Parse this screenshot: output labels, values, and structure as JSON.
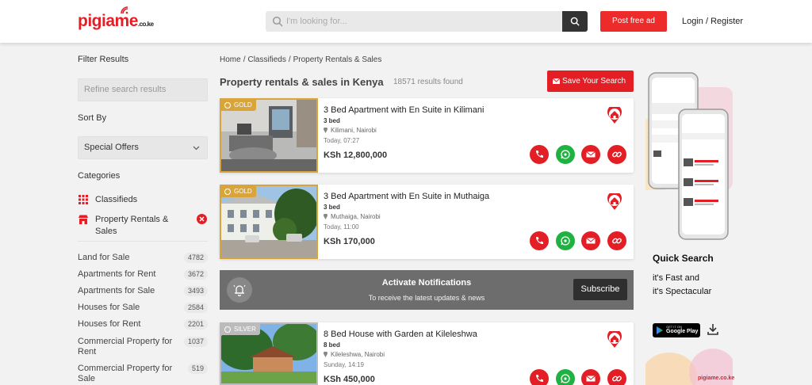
{
  "header": {
    "logo": {
      "part1": "pigia",
      "part2": "me",
      "tld": ".co.ke"
    },
    "search_placeholder": "I'm looking for...",
    "post_label": "Post free ad",
    "login_label": "Login / Register"
  },
  "sidebar": {
    "filter_title": "Filter Results",
    "refine_placeholder": "Refine search results",
    "sort_title": "Sort By",
    "sort_value": "Special Offers",
    "categories_title": "Categories",
    "categories": [
      {
        "label": "Classifieds",
        "icon": "grid-icon"
      },
      {
        "label": "Property Rentals & Sales",
        "icon": "store-icon"
      }
    ],
    "subcategories": [
      {
        "label": "Land for Sale",
        "count": "4782"
      },
      {
        "label": "Apartments for Rent",
        "count": "3672"
      },
      {
        "label": "Apartments for Sale",
        "count": "3493"
      },
      {
        "label": "Houses for Sale",
        "count": "2584"
      },
      {
        "label": "Houses for Rent",
        "count": "2201"
      },
      {
        "label": "Commercial Property for Rent",
        "count": "1037"
      },
      {
        "label": "Commercial Property for Sale",
        "count": "519"
      }
    ]
  },
  "main": {
    "breadcrumb": [
      "Home",
      "/",
      "Classifieds",
      "/",
      "Property Rentals & Sales"
    ],
    "title": "Property rentals & sales in Kenya",
    "results": "18571 results found",
    "save_search": "Save Your Search",
    "listings": [
      {
        "tier": "GOLD",
        "title": "3 Bed Apartment with En Suite in Kilimani",
        "beds": "3 bed",
        "location": "Kilimani, Nairobi",
        "time": "Today, 07:27",
        "price": "KSh 12,800,000"
      },
      {
        "tier": "GOLD",
        "title": "3 Bed Apartment with En Suite in Muthaiga",
        "beds": "3 bed",
        "location": "Muthaiga, Nairobi",
        "time": "Today, 11:00",
        "price": "KSh 170,000"
      },
      {
        "tier": "SILVER",
        "title": "8 Bed House with Garden at Kileleshwa",
        "beds": "8 bed",
        "location": "Kileleshwa, Nairobi",
        "time": "Sunday, 14:19",
        "price": "KSh 450,000"
      }
    ],
    "notify": {
      "title": "Activate Notifications",
      "subtitle": "To receive the latest updates & news",
      "button": "Subscribe"
    }
  },
  "ad": {
    "headline": "Quick Search",
    "line1": "it's Fast and",
    "line2": "it's Spectacular",
    "store_small": "GET IT ON",
    "store_big": "Google Play",
    "brand": "pigiame.co.ke"
  },
  "colors": {
    "brand_red": "#e31e24",
    "gold": "#d9a53a",
    "silver": "#bbbbbb",
    "whatsapp_green": "#1fb141"
  }
}
